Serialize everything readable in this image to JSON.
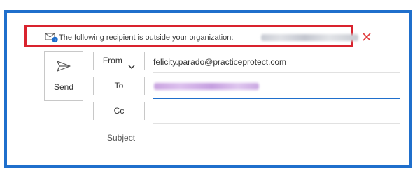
{
  "mailtip": {
    "message": "The following recipient is outside your organization:",
    "icon": "mailtip-envelope-info-icon",
    "close_icon": "close-icon",
    "accent_color": "#d9232e"
  },
  "compose": {
    "send_label": "Send",
    "send_icon": "send-icon",
    "from_label": "From",
    "from_address": "felicity.parado@practiceprotect.com",
    "to_label": "To",
    "cc_label": "Cc",
    "subject_label": "Subject",
    "frame_color": "#1f6fcc"
  }
}
